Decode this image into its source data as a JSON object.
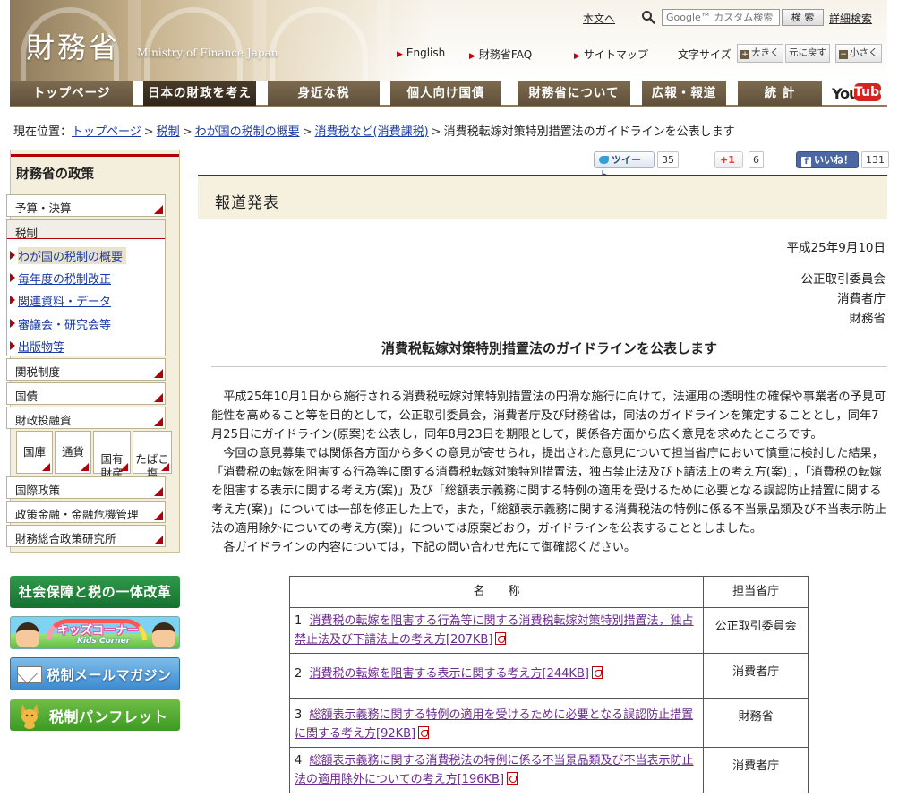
{
  "header": {
    "site_title": "財務省",
    "site_title_en": "Ministry of Finance Japan",
    "skip_link": "本文へ",
    "search_placeholder": "Google™ カスタム検索",
    "search_button": "検 索",
    "advanced_search": "詳細検索",
    "util_links": [
      "English",
      "財務省FAQ",
      "サイトマップ"
    ],
    "font_size_label": "文字サイズ",
    "font_size_buttons": [
      {
        "sym": "+",
        "label": "大きく"
      },
      {
        "sym": "□",
        "label": "元に戻す"
      },
      {
        "sym": "−",
        "label": "小さく"
      }
    ]
  },
  "nav": {
    "tabs": [
      "トップページ",
      "日本の財政を考える",
      "身近な税",
      "個人向け国債",
      "財務省について",
      "広報・報道",
      "統 計"
    ],
    "active_index": 1,
    "youtube_you": "You",
    "youtube_tube": "Tube"
  },
  "breadcrumb": {
    "prefix": "現在位置：",
    "items": [
      "トップページ",
      "税制",
      "わが国の税制の概要",
      "消費税など(消費課税)"
    ],
    "current": "消費税転嫁対策特別措置法のガイドラインを公表します"
  },
  "sidebar": {
    "title": "財務省の政策",
    "menu_budget": "予算・決算",
    "menu_tax": "税制",
    "tax_submenu": [
      "わが国の税制の概要",
      "毎年度の税制改正",
      "関連資料・データ",
      "審議会・研究会等",
      "出版物等"
    ],
    "menu_customs": "関税制度",
    "menu_bonds": "国債",
    "menu_filp": "財政投融資",
    "grid": [
      "国庫",
      "通貨",
      "国有\n財産",
      "たばこ\n塩"
    ],
    "menu_intl": "国際政策",
    "menu_fin": "政策金融・金融危機管理",
    "menu_pri": "財務総合政策研究所",
    "banner_reform": "社会保障と税の一体改革",
    "banner_kids_title": "キッズコーナー",
    "banner_kids_sub": "Kids Corner",
    "banner_mail": "税制メールマガジン",
    "banner_pamphlet": "税制パンフレット"
  },
  "social": {
    "tweet_label": "ツイート",
    "tweet_count": "35",
    "gplus_label": "+1",
    "gplus_count": "6",
    "fb_label": "いいね！",
    "fb_count": "131"
  },
  "article": {
    "section_title": "報道発表",
    "date": "平成25年9月10日",
    "agencies": [
      "公正取引委員会",
      "消費者庁",
      "財務省"
    ],
    "title": "消費税転嫁対策特別措置法のガイドラインを公表します",
    "paragraphs": [
      "平成25年10月1日から施行される消費税転嫁対策特別措置法の円滑な施行に向けて，法運用の透明性の確保や事業者の予見可能性を高めること等を目的として，公正取引委員会，消費者庁及び財務省は，同法のガイドラインを策定することとし，同年7月25日にガイドライン(原案)を公表し，同年8月23日を期限として，関係各方面から広く意見を求めたところです。",
      "今回の意見募集では関係各方面から多くの意見が寄せられ，提出された意見について担当省庁において慎重に検討した結果，「消費税の転嫁を阻害する行為等に関する消費税転嫁対策特別措置法，独占禁止法及び下請法上の考え方(案)」，「消費税の転嫁を阻害する表示に関する考え方(案)」及び「総額表示義務に関する特例の適用を受けるために必要となる誤認防止措置に関する考え方(案)」については一部を修正した上で，また，「総額表示義務に関する消費税法の特例に係る不当景品類及び不当表示防止法の適用除外についての考え方(案)」については原案どおり，ガイドラインを公表することとしました。",
      "各ガイドラインの内容については，下記の問い合わせ先にて御確認ください。"
    ]
  },
  "table": {
    "headers": [
      "名　　称",
      "担当省庁"
    ],
    "rows": [
      {
        "num": "1",
        "name": "消費税の転嫁を阻害する行為等に関する消費税転嫁対策特別措置法，独占禁止法及び下請法上の考え方[207KB]",
        "agency": "公正取引委員会"
      },
      {
        "num": "2",
        "name": "消費税の転嫁を阻害する表示に関する考え方[244KB]",
        "agency": "消費者庁"
      },
      {
        "num": "3",
        "name": "総額表示義務に関する特例の適用を受けるために必要となる誤認防止措置に関する考え方[92KB]",
        "agency": "財務省"
      },
      {
        "num": "4",
        "name": "総額表示義務に関する消費税法の特例に係る不当景品類及び不当表示防止法の適用除外についての考え方[196KB]",
        "agency": "消費者庁"
      }
    ]
  },
  "colors": {
    "brand_brown": "#7d6c50",
    "accent_red": "#b0000a",
    "link_blue": "#1a3aa6",
    "visited_purple": "#6b2a8f"
  }
}
